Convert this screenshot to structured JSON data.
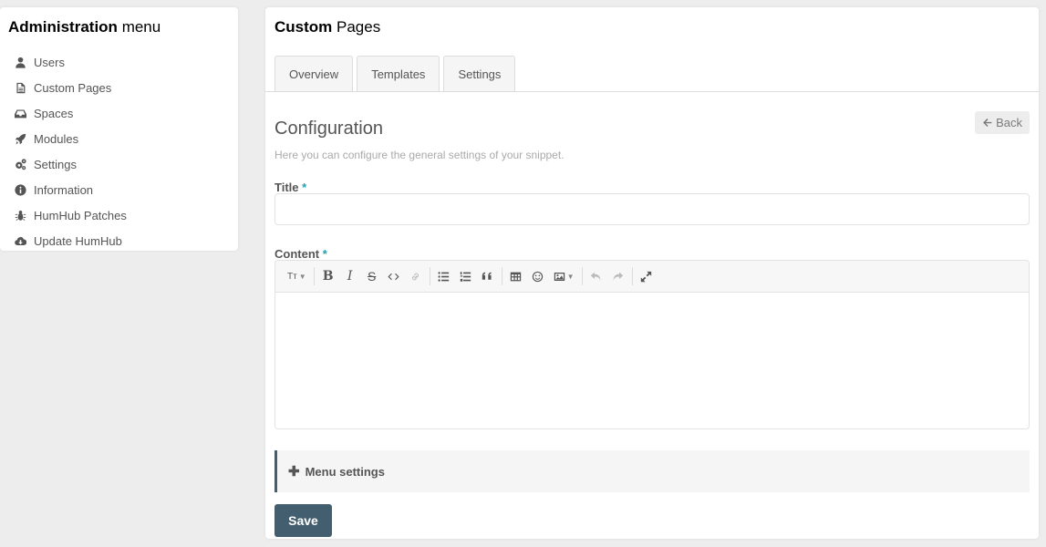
{
  "sidebar": {
    "title_bold": "Administration",
    "title_rest": "menu",
    "items": [
      {
        "label": "Users",
        "icon": "user-icon"
      },
      {
        "label": "Custom Pages",
        "icon": "file-icon"
      },
      {
        "label": "Spaces",
        "icon": "inbox-icon"
      },
      {
        "label": "Modules",
        "icon": "rocket-icon"
      },
      {
        "label": "Settings",
        "icon": "cogs-icon"
      },
      {
        "label": "Information",
        "icon": "info-icon"
      },
      {
        "label": "HumHub Patches",
        "icon": "bug-icon"
      },
      {
        "label": "Update HumHub",
        "icon": "cloud-download-icon"
      }
    ]
  },
  "panel": {
    "title_bold": "Custom",
    "title_rest": "Pages",
    "tabs": [
      {
        "label": "Overview"
      },
      {
        "label": "Templates"
      },
      {
        "label": "Settings"
      }
    ]
  },
  "form": {
    "heading": "Configuration",
    "back_label": "Back",
    "help_text": "Here you can configure the general settings of your snippet.",
    "title_label": "Title",
    "title_value": "",
    "content_label": "Content",
    "required_mark": "*",
    "toolbar_heading": "Tт",
    "menu_settings_label": "Menu settings",
    "save_label": "Save"
  },
  "colors": {
    "accent": "#21a1b3",
    "primary": "#435f6f",
    "background": "#ededed"
  }
}
